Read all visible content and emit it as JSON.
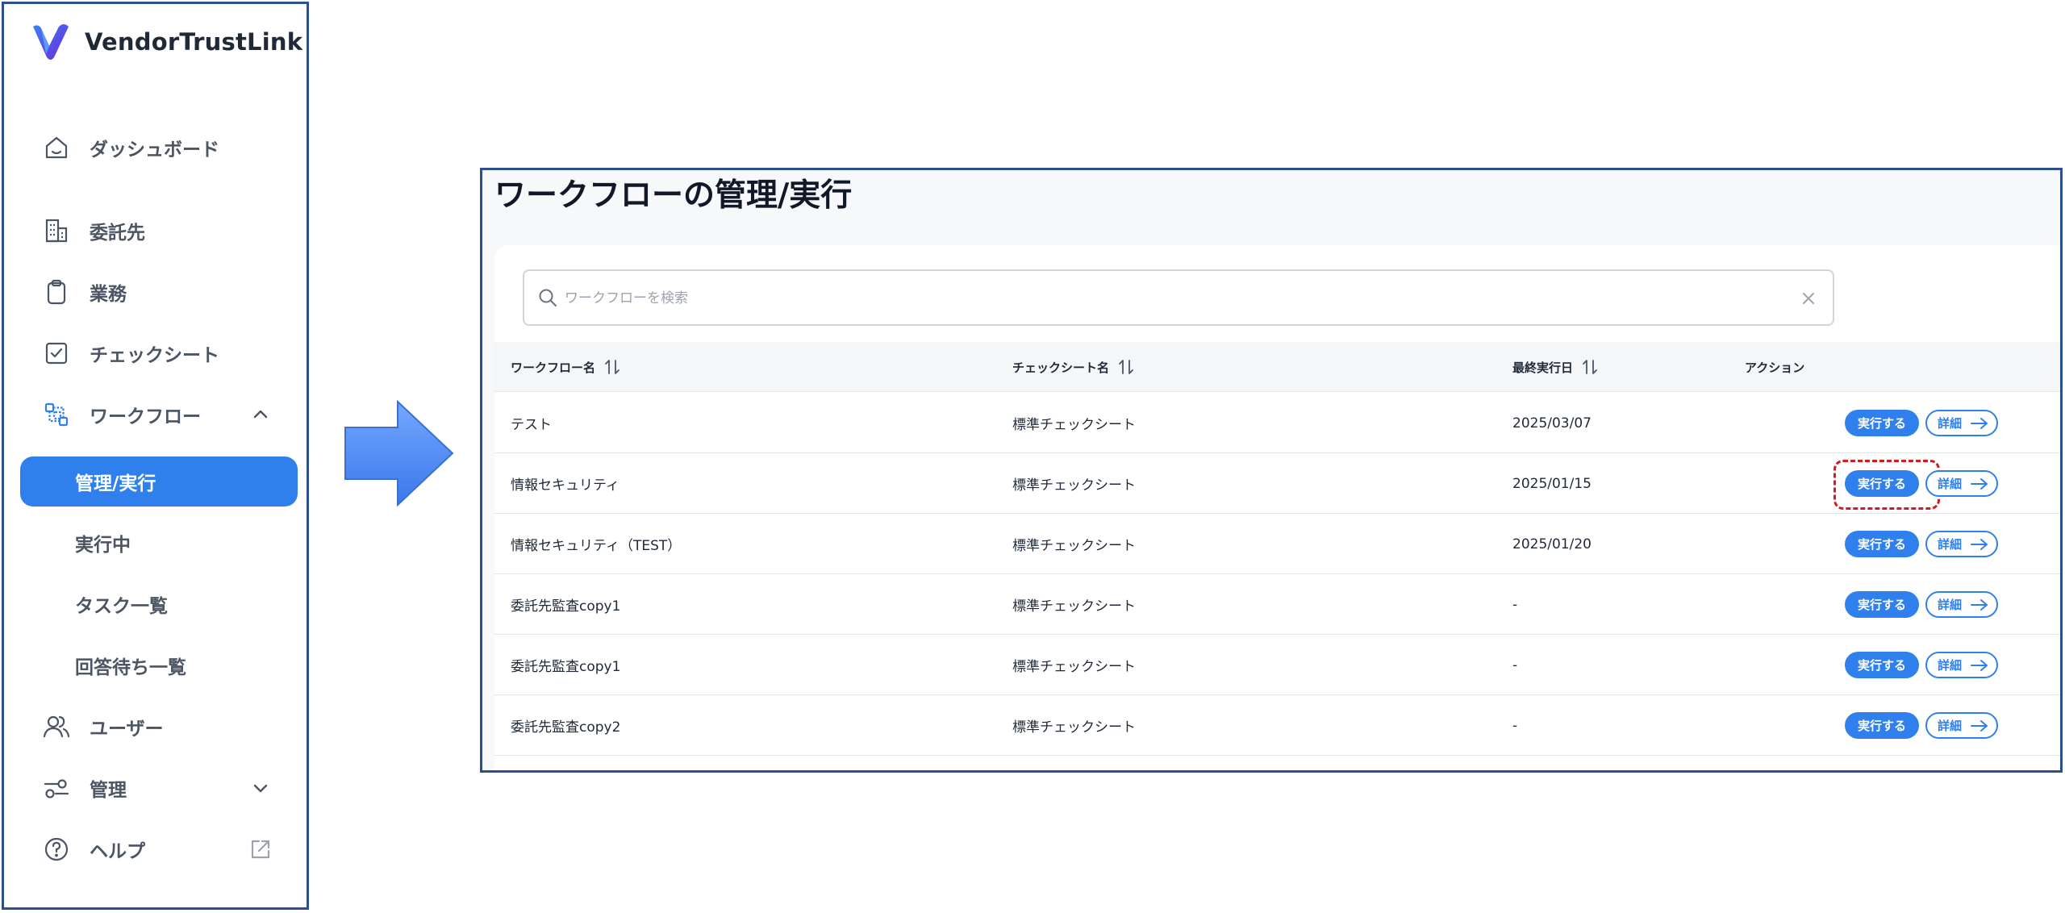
{
  "brand": {
    "name": "VendorTrustLink",
    "accent": "#2f80ed",
    "logo_gradient": [
      "#2f80ed",
      "#7b3fe4"
    ]
  },
  "sidebar": {
    "items": [
      {
        "label": "ダッシュボード",
        "icon": "home-icon"
      },
      {
        "label": "委託先",
        "icon": "building-icon"
      },
      {
        "label": "業務",
        "icon": "clipboard-icon"
      },
      {
        "label": "チェックシート",
        "icon": "checkbox-icon"
      },
      {
        "label": "ワークフロー",
        "icon": "workflow-icon",
        "expanded": true
      },
      {
        "label": "ユーザー",
        "icon": "users-icon"
      },
      {
        "label": "管理",
        "icon": "sliders-icon",
        "expanded": false
      },
      {
        "label": "ヘルプ",
        "icon": "help-icon",
        "external": true
      }
    ],
    "workflow_sub": [
      {
        "label": "管理/実行",
        "active": true
      },
      {
        "label": "実行中"
      },
      {
        "label": "タスク一覧"
      },
      {
        "label": "回答待ち一覧"
      }
    ]
  },
  "main": {
    "title": "ワークフローの管理/実行",
    "search": {
      "placeholder": "ワークフローを検索",
      "value": ""
    },
    "columns": [
      "ワークフロー名",
      "チェックシート名",
      "最終実行日",
      "アクション"
    ],
    "rows": [
      {
        "name": "テスト",
        "sheet": "標準チェックシート",
        "date": "2025/03/07"
      },
      {
        "name": "情報セキュリティ",
        "sheet": "標準チェックシート",
        "date": "2025/01/15",
        "highlighted": true
      },
      {
        "name": "情報セキュリティ（TEST）",
        "sheet": "標準チェックシート",
        "date": "2025/01/20"
      },
      {
        "name": "委託先監査copy1",
        "sheet": "標準チェックシート",
        "date": "-"
      },
      {
        "name": "委託先監査copy1",
        "sheet": "標準チェックシート",
        "date": "-"
      },
      {
        "name": "委託先監査copy2",
        "sheet": "標準チェックシート",
        "date": "-"
      }
    ],
    "run_label": "実行する",
    "detail_label": "詳細",
    "highlight_color": "#d71920"
  }
}
